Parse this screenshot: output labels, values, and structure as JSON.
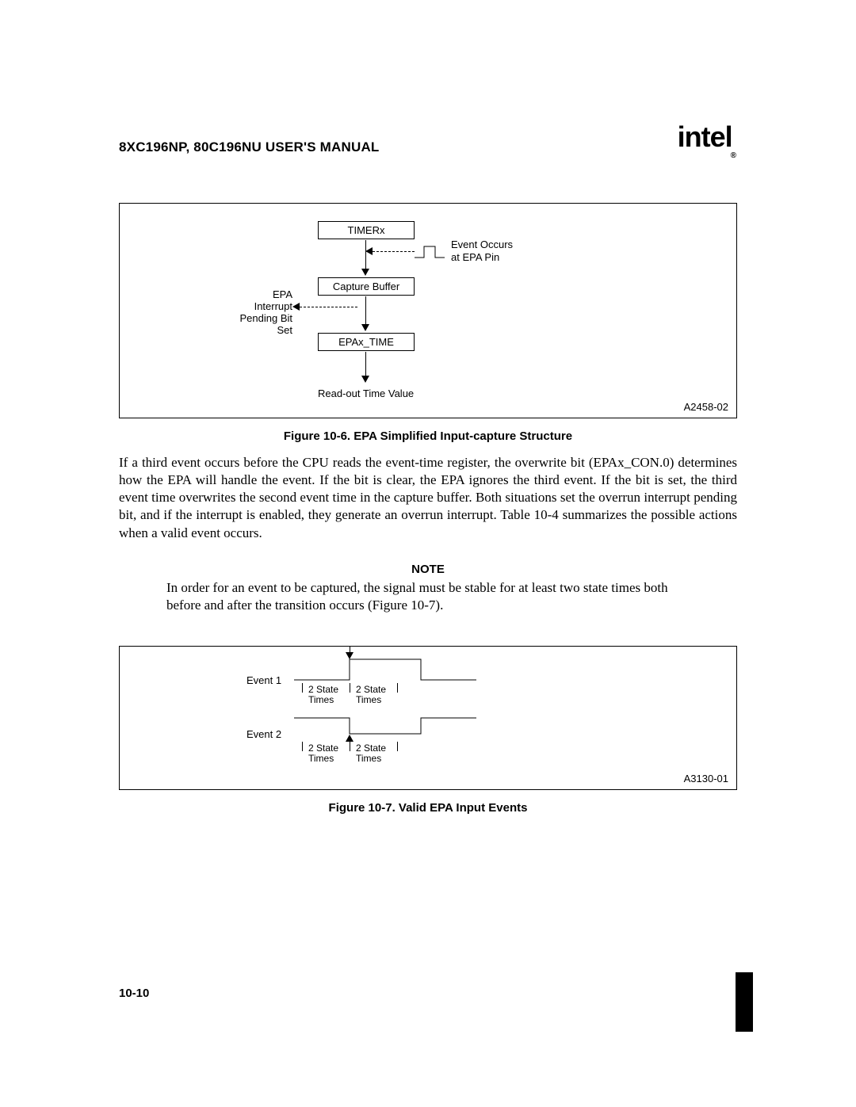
{
  "header": {
    "manual_title": "8XC196NP, 80C196NU USER'S MANUAL",
    "logo_text": "intel",
    "logo_sub": "®"
  },
  "figure6": {
    "block_timer": "TIMERx",
    "block_capture": "Capture Buffer",
    "block_epax": "EPAx_TIME",
    "label_event_l1": "Event Occurs",
    "label_event_l2": "at EPA Pin",
    "label_epa_l1": "EPA",
    "label_epa_l2": "Interrupt",
    "label_epa_l3": "Pending Bit",
    "label_epa_l4": "Set",
    "label_readout": "Read-out Time Value",
    "fig_id": "A2458-02",
    "caption": "Figure 10-6.  EPA Simplified Input-capture Structure"
  },
  "paragraph1": "If a third event occurs before the CPU reads the event-time register, the overwrite bit (EPAx_CON.0) determines how the EPA will handle the event. If the bit is clear, the EPA ignores the third event. If the bit is set, the third event time overwrites the second event time in the capture buffer. Both situations set the overrun interrupt pending bit, and if the interrupt is enabled, they generate an overrun interrupt. Table 10-4 summarizes the possible actions when a valid event occurs.",
  "note": {
    "heading": "NOTE",
    "body": "In order for an event to be captured, the signal must be stable for at least two state times both before and after the transition occurs (Figure 10-7)."
  },
  "figure7": {
    "event1": "Event 1",
    "event2": "Event 2",
    "st_l1": "2 State",
    "st_l2": "Times",
    "fig_id": "A3130-01",
    "caption": "Figure 10-7.  Valid EPA Input Events"
  },
  "page_number": "10-10"
}
